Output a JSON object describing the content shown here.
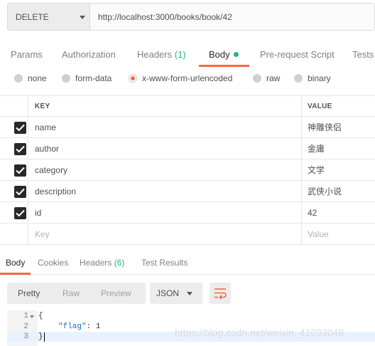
{
  "request": {
    "method": "DELETE",
    "url": "http://localhost:3000/books/book/42"
  },
  "request_tabs": [
    {
      "label": "Params"
    },
    {
      "label": "Authorization"
    },
    {
      "label": "Headers",
      "count": "(1)"
    },
    {
      "label": "Body"
    },
    {
      "label": "Pre-request Script"
    },
    {
      "label": "Tests"
    }
  ],
  "body_types": [
    {
      "label": "none",
      "checked": false
    },
    {
      "label": "form-data",
      "checked": false
    },
    {
      "label": "x-www-form-urlencoded",
      "checked": true
    },
    {
      "label": "raw",
      "checked": false
    },
    {
      "label": "binary",
      "checked": false
    }
  ],
  "table": {
    "key_header": "KEY",
    "value_header": "VALUE",
    "rows": [
      {
        "key": "name",
        "value": "神雕侠侣",
        "checked": true
      },
      {
        "key": "author",
        "value": "金庸",
        "checked": true
      },
      {
        "key": "category",
        "value": "文学",
        "checked": true
      },
      {
        "key": "description",
        "value": "武侠小说",
        "checked": true
      },
      {
        "key": "id",
        "value": "42",
        "checked": true
      }
    ],
    "key_placeholder": "Key",
    "value_placeholder": "Value"
  },
  "response_tabs": [
    {
      "label": "Body"
    },
    {
      "label": "Cookies"
    },
    {
      "label": "Headers",
      "count": "(6)"
    },
    {
      "label": "Test Results"
    }
  ],
  "view_modes": [
    "Pretty",
    "Raw",
    "Preview"
  ],
  "format": "JSON",
  "code_lines": [
    {
      "num": "1",
      "text": "{"
    },
    {
      "num": "2",
      "key": "\"flag\"",
      "sep": ": ",
      "value": "1"
    },
    {
      "num": "3",
      "text": "}"
    }
  ],
  "watermark": "https://blog.csdn.net/weixin_41033048",
  "colors": {
    "accent": "#f26b3a",
    "count_green": "#26b47f"
  }
}
